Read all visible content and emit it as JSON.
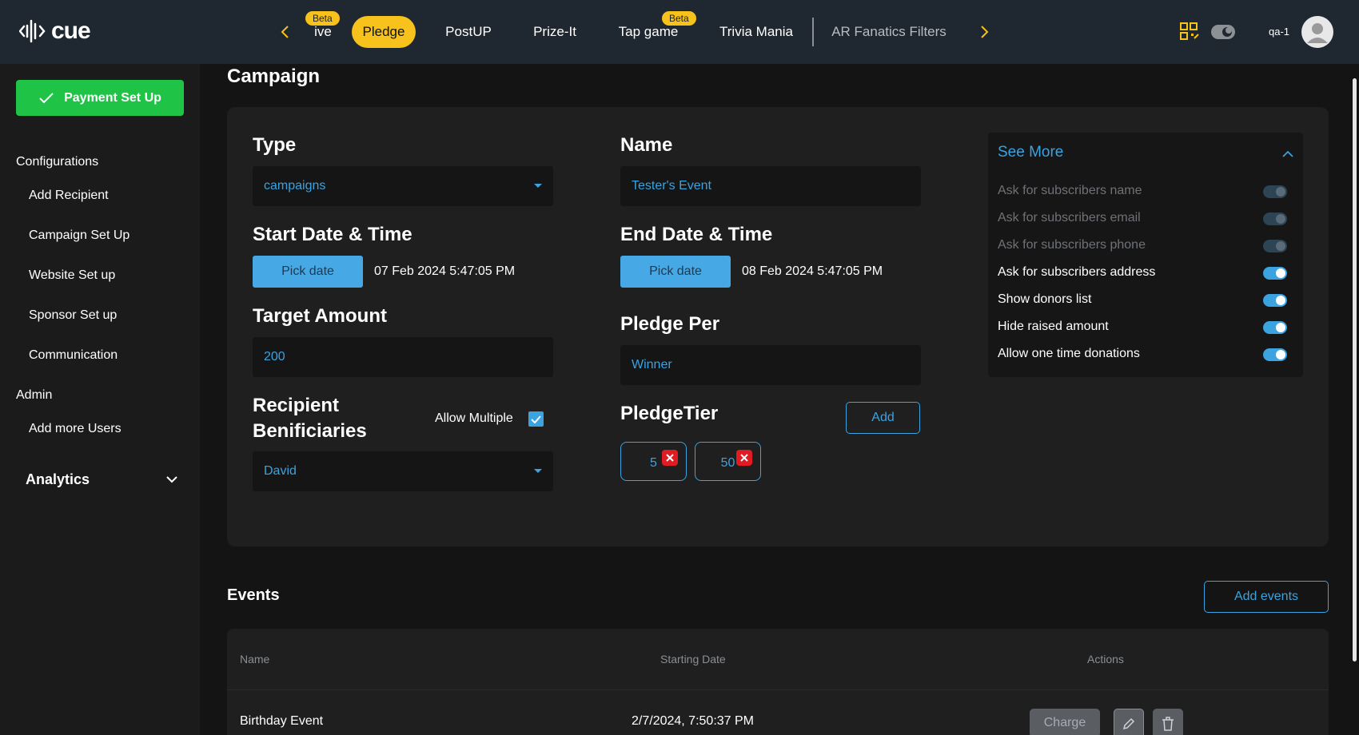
{
  "app": {
    "logo_text": "cue",
    "user_label": "qa-1"
  },
  "nav": {
    "prev_icon": "chevron-left-icon",
    "next_icon": "chevron-right-icon",
    "tabs": [
      {
        "label": "ive",
        "badge": "Beta"
      },
      {
        "label": "Pledge",
        "active": true
      },
      {
        "label": "PostUP"
      },
      {
        "label": "Prize-It"
      },
      {
        "label": "Tap game",
        "badge": "Beta"
      },
      {
        "label": "Trivia Mania"
      },
      {
        "label": "AR Fanatics Filters"
      }
    ]
  },
  "sidebar": {
    "payment_button": "Payment Set Up",
    "configurations_heading": "Configurations",
    "config_items": [
      "Add Recipient",
      "Campaign Set Up",
      "Website Set up",
      "Sponsor Set up",
      "Communication"
    ],
    "admin_heading": "Admin",
    "admin_items": [
      "Add more Users"
    ],
    "analytics_label": "Analytics"
  },
  "campaign": {
    "title": "Campaign",
    "type_label": "Type",
    "type_value": "campaigns",
    "name_label": "Name",
    "name_value": "Tester's Event",
    "start_label": "Start Date & Time",
    "start_button": "Pick date",
    "start_value": "07 Feb 2024 5:47:05 PM",
    "end_label": "End Date & Time",
    "end_button": "Pick date",
    "end_value": "08 Feb 2024 5:47:05 PM",
    "target_label": "Target Amount",
    "target_value": "200",
    "pledge_per_label": "Pledge Per",
    "pledge_per_value": "Winner",
    "recipient_label_line1": "Recipient",
    "recipient_label_line2": "Benificiaries",
    "allow_multiple_label": "Allow Multiple",
    "allow_multiple_checked": true,
    "recipient_value": "David",
    "pledge_tier_label": "PledgeTier",
    "pledge_tier_add": "Add",
    "pledge_tiers": [
      "5",
      "50"
    ]
  },
  "see_more": {
    "title": "See More",
    "options": [
      {
        "label": "Ask for subscribers name",
        "enabled": false
      },
      {
        "label": "Ask for subscribers email",
        "enabled": false
      },
      {
        "label": "Ask for subscribers phone",
        "enabled": false
      },
      {
        "label": "Ask for subscribers address",
        "enabled": true
      },
      {
        "label": "Show donors list",
        "enabled": true
      },
      {
        "label": "Hide raised amount",
        "enabled": true
      },
      {
        "label": "Allow one time donations",
        "enabled": true
      }
    ]
  },
  "events": {
    "title": "Events",
    "add_button": "Add events",
    "columns": [
      "Name",
      "Starting Date",
      "Actions"
    ],
    "rows": [
      {
        "name": "Birthday Event",
        "starting_date": "2/7/2024, 7:50:37 PM",
        "charge_label": "Charge"
      }
    ]
  },
  "colors": {
    "accent": "#3aa3e0",
    "brand_yellow": "#f6c21b",
    "success": "#1fc447",
    "danger": "#e01b24"
  }
}
